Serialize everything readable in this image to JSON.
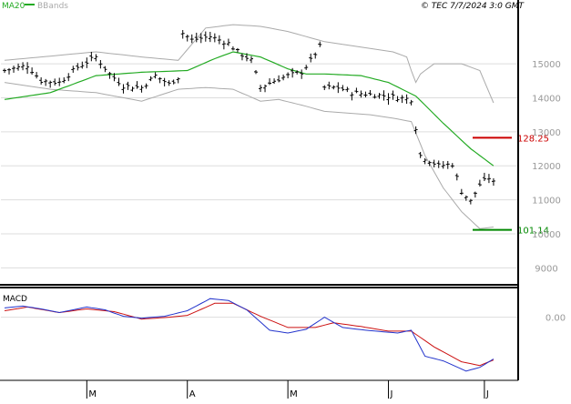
{
  "header": {
    "legend_ma": "MA20",
    "legend_bbands": "BBands",
    "copyright": "© TEC 7/7/2024 3:0 GMT"
  },
  "colors": {
    "ma": "#22aa22",
    "bbands": "#aaaaaa",
    "price": "#000000",
    "resistance": "#cc0000",
    "support": "#008800",
    "macd_line": "#2233cc",
    "signal_line": "#cc1111",
    "grid": "#dddddd",
    "axis": "#888888"
  },
  "chart_data": [
    {
      "type": "line",
      "title": "",
      "ylim": [
        8500,
        16500
      ],
      "y_ticks": [
        {
          "value": 9000,
          "label": "9000"
        },
        {
          "value": 10000,
          "label": "10000"
        },
        {
          "value": 11000,
          "label": "11000"
        },
        {
          "value": 12000,
          "label": "12000"
        },
        {
          "value": 13000,
          "label": "13000"
        },
        {
          "value": 14000,
          "label": "14000"
        },
        {
          "value": 15000,
          "label": "15000"
        }
      ],
      "x_ticks": [
        {
          "index": 18,
          "label": "M"
        },
        {
          "index": 40,
          "label": "A"
        },
        {
          "index": 62,
          "label": "M"
        },
        {
          "index": 84,
          "label": "J"
        },
        {
          "index": 105,
          "label": "J"
        }
      ],
      "n_bars": 110,
      "price_anchors": [
        [
          0,
          14800
        ],
        [
          5,
          14950
        ],
        [
          8,
          14500
        ],
        [
          12,
          14450
        ],
        [
          16,
          14900
        ],
        [
          20,
          15200
        ],
        [
          23,
          14700
        ],
        [
          26,
          14350
        ],
        [
          30,
          14300
        ],
        [
          33,
          14650
        ],
        [
          36,
          14400
        ],
        [
          38,
          14600
        ],
        [
          39,
          15900
        ],
        [
          41,
          15700
        ],
        [
          45,
          15800
        ],
        [
          49,
          15600
        ],
        [
          51,
          15350
        ],
        [
          54,
          15100
        ],
        [
          56,
          14300
        ],
        [
          59,
          14500
        ],
        [
          62,
          14650
        ],
        [
          65,
          14750
        ],
        [
          67,
          15100
        ],
        [
          69,
          15500
        ],
        [
          70,
          14300
        ],
        [
          73,
          14300
        ],
        [
          76,
          14150
        ],
        [
          80,
          14100
        ],
        [
          84,
          14050
        ],
        [
          89,
          13950
        ],
        [
          91,
          12300
        ],
        [
          95,
          12000
        ],
        [
          98,
          12050
        ],
        [
          100,
          11250
        ],
        [
          102,
          10950
        ],
        [
          104,
          11450
        ],
        [
          106,
          11650
        ],
        [
          107,
          11500
        ]
      ],
      "ma_anchors": [
        [
          0,
          13950
        ],
        [
          10,
          14150
        ],
        [
          20,
          14650
        ],
        [
          30,
          14750
        ],
        [
          40,
          14800
        ],
        [
          46,
          15150
        ],
        [
          50,
          15350
        ],
        [
          56,
          15200
        ],
        [
          62,
          14850
        ],
        [
          66,
          14700
        ],
        [
          70,
          14700
        ],
        [
          78,
          14650
        ],
        [
          84,
          14450
        ],
        [
          90,
          14050
        ],
        [
          96,
          13250
        ],
        [
          102,
          12500
        ],
        [
          107,
          12000
        ]
      ],
      "bb_upper_anchors": [
        [
          0,
          15100
        ],
        [
          20,
          15350
        ],
        [
          30,
          15200
        ],
        [
          38,
          15100
        ],
        [
          44,
          16050
        ],
        [
          50,
          16150
        ],
        [
          56,
          16100
        ],
        [
          62,
          15950
        ],
        [
          66,
          15800
        ],
        [
          70,
          15650
        ],
        [
          80,
          15450
        ],
        [
          85,
          15350
        ],
        [
          88,
          15200
        ],
        [
          89,
          14800
        ],
        [
          90,
          14450
        ],
        [
          91,
          14700
        ],
        [
          94,
          15000
        ],
        [
          100,
          15000
        ],
        [
          104,
          14800
        ],
        [
          107,
          13850
        ]
      ],
      "bb_lower_anchors": [
        [
          0,
          14450
        ],
        [
          10,
          14250
        ],
        [
          20,
          14150
        ],
        [
          30,
          13900
        ],
        [
          38,
          14250
        ],
        [
          44,
          14300
        ],
        [
          50,
          14250
        ],
        [
          56,
          13900
        ],
        [
          60,
          13950
        ],
        [
          66,
          13750
        ],
        [
          70,
          13600
        ],
        [
          80,
          13500
        ],
        [
          85,
          13400
        ],
        [
          89,
          13300
        ],
        [
          92,
          12300
        ],
        [
          96,
          11350
        ],
        [
          100,
          10650
        ],
        [
          104,
          10150
        ],
        [
          107,
          10200
        ]
      ],
      "resistance": {
        "value": 12825,
        "label": "128.25",
        "start_index": 102
      },
      "support": {
        "value": 10114,
        "label": "101.14",
        "start_index": 102
      }
    },
    {
      "type": "line",
      "title": "MACD",
      "ylim": [
        -340,
        160
      ],
      "y_ticks": [
        {
          "value": 0,
          "label": "0.00"
        }
      ],
      "macd_anchors": [
        [
          0,
          50
        ],
        [
          4,
          60
        ],
        [
          8,
          45
        ],
        [
          12,
          25
        ],
        [
          18,
          55
        ],
        [
          22,
          40
        ],
        [
          26,
          5
        ],
        [
          30,
          -5
        ],
        [
          35,
          5
        ],
        [
          40,
          35
        ],
        [
          45,
          100
        ],
        [
          49,
          90
        ],
        [
          53,
          40
        ],
        [
          58,
          -70
        ],
        [
          62,
          -85
        ],
        [
          66,
          -65
        ],
        [
          70,
          0
        ],
        [
          74,
          -55
        ],
        [
          79,
          -70
        ],
        [
          86,
          -85
        ],
        [
          89,
          -70
        ],
        [
          92,
          -210
        ],
        [
          96,
          -235
        ],
        [
          101,
          -290
        ],
        [
          104,
          -270
        ],
        [
          107,
          -225
        ]
      ],
      "signal_anchors": [
        [
          0,
          35
        ],
        [
          5,
          55
        ],
        [
          12,
          25
        ],
        [
          18,
          45
        ],
        [
          24,
          30
        ],
        [
          30,
          -10
        ],
        [
          36,
          0
        ],
        [
          40,
          10
        ],
        [
          46,
          75
        ],
        [
          50,
          75
        ],
        [
          56,
          5
        ],
        [
          62,
          -55
        ],
        [
          68,
          -55
        ],
        [
          72,
          -30
        ],
        [
          78,
          -50
        ],
        [
          84,
          -75
        ],
        [
          89,
          -75
        ],
        [
          94,
          -160
        ],
        [
          100,
          -240
        ],
        [
          104,
          -260
        ],
        [
          107,
          -230
        ]
      ]
    }
  ]
}
